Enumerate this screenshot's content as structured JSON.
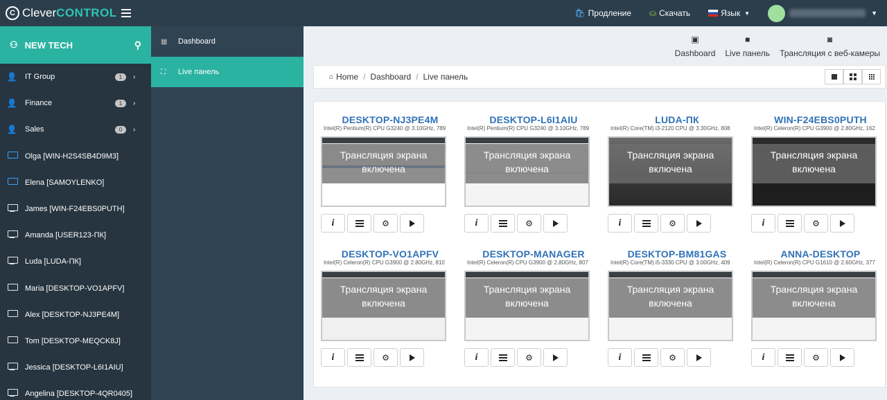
{
  "app": {
    "brand_clever": "Clever",
    "brand_control": "CONTROL"
  },
  "topnav": {
    "extend": "Продление",
    "download": "Скачать",
    "language": "Язык"
  },
  "sidebar": {
    "title": "NEW TECH",
    "groups": [
      {
        "label": "IT Group",
        "count": "1"
      },
      {
        "label": "Finance",
        "count": "1"
      },
      {
        "label": "Sales",
        "count": "0"
      }
    ],
    "computers": [
      {
        "label": "Olga [WIN-H2S4SB4D9M3]",
        "online": true
      },
      {
        "label": "Elena [SAMOYLENKO]",
        "online": true
      },
      {
        "label": "James [WIN-F24EBS0PUTH]",
        "online": false
      },
      {
        "label": "Amanda [USER123-ПК]",
        "online": false
      },
      {
        "label": "Luda [LUDA-ПК]",
        "online": false
      },
      {
        "label": "Maria [DESKTOP-VO1APFV]",
        "online": false
      },
      {
        "label": "Alex [DESKTOP-NJ3PE4M]",
        "online": false
      },
      {
        "label": "Tom [DESKTOP-MEQCK8J]",
        "online": false
      },
      {
        "label": "Jessica [DESKTOP-L6I1AIU]",
        "online": false
      },
      {
        "label": "Angelina [DESKTOP-4QR0405]",
        "online": false
      }
    ]
  },
  "subnav": {
    "dashboard": "Dashboard",
    "live": "Live панель"
  },
  "toolbar": {
    "dashboard": "Dashboard",
    "live": "Live панель",
    "webcam": "Трансляция с веб-камеры"
  },
  "breadcrumb": {
    "home": "Home",
    "dashboard": "Dashboard",
    "current": "Live панель"
  },
  "overlay": {
    "line1": "Трансляция экрана",
    "line2": "включена"
  },
  "cards": [
    {
      "name": "DESKTOP-NJ3PE4M",
      "cpu": "Intel(R) Pentium(R) CPU G3240 @ 3.10GHz, 789"
    },
    {
      "name": "DESKTOP-L6I1AIU",
      "cpu": "Intel(R) Pentium(R) CPU G3240 @ 3.10GHz, 789"
    },
    {
      "name": "LUDA-ПК",
      "cpu": "Intel(R) Core(TM) i3-2120 CPU @ 3.30GHz, 808"
    },
    {
      "name": "WIN-F24EBS0PUTH",
      "cpu": "Intel(R) Celeron(R) CPU G3900 @ 2.80GHz, 162"
    },
    {
      "name": "DESKTOP-VO1APFV",
      "cpu": "Intel(R) Celeron(R) CPU G3900 @ 2.80GHz, 810"
    },
    {
      "name": "DESKTOP-MANAGER",
      "cpu": "Intel(R) Celeron(R) CPU G3900 @ 2.80GHz, 807"
    },
    {
      "name": "DESKTOP-BM81GAS",
      "cpu": "Intel(R) Core(TM) i5-3330 CPU @ 3.00GHz, 409"
    },
    {
      "name": "ANNA-DESKTOP",
      "cpu": "Intel(R) Celeron(R) CPU G1610 @ 2.60GHz, 377"
    }
  ]
}
